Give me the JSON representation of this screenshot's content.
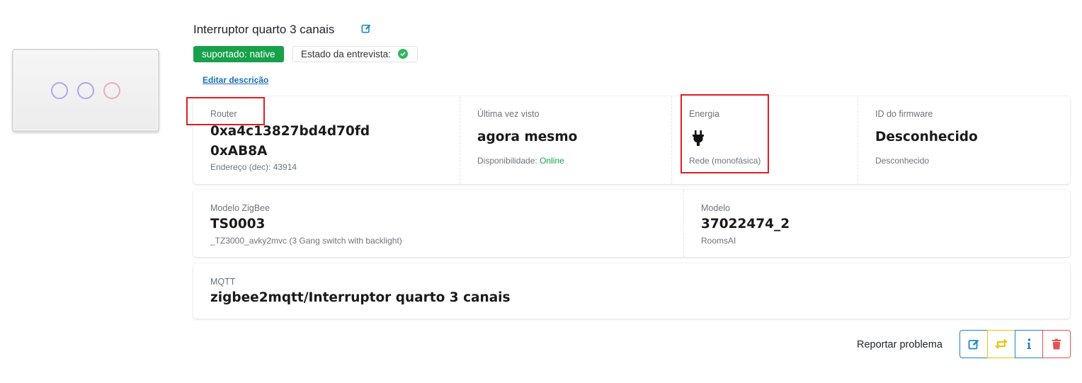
{
  "device": {
    "title": "Interruptor quarto 3 canais",
    "supported_badge": "suportado: native",
    "interview_label": "Estado da entrevista:",
    "edit_description": "Editar descrição"
  },
  "info": {
    "router_label": "Router",
    "ieee_address": "0xa4c13827bd4d70fd",
    "network_address": "0xAB8A",
    "address_dec": "Endereço (dec): 43914",
    "last_seen_label": "Última vez visto",
    "last_seen_value": "agora mesmo",
    "availability_label": "Disponibilidade:",
    "availability_value": "Online",
    "power_label": "Energia",
    "power_icon": "plug-icon",
    "power_source": "Rede (monofásica)",
    "firmware_label": "ID do firmware",
    "firmware_value": "Desconhecido",
    "firmware_sub": "Desconhecido"
  },
  "model": {
    "zigbee_model_label": "Modelo ZigBee",
    "zigbee_model_value": "TS0003",
    "zigbee_model_sub": "_TZ3000_avky2mvc (3 Gang switch with backlight)",
    "model_label": "Modelo",
    "model_value": "37022474_2",
    "vendor": "RoomsAI"
  },
  "mqtt": {
    "label": "MQTT",
    "topic": "zigbee2mqtt/Interruptor quarto 3 canais"
  },
  "actions": {
    "report_problem": "Reportar problema",
    "buttons": [
      "edit-icon",
      "swap-icon",
      "info-icon",
      "trash-icon"
    ]
  },
  "colors": {
    "accent": "#1b88c4",
    "success": "#17a14b",
    "warning": "#f2c200",
    "danger": "#e55353",
    "highlight": "#e01e27"
  }
}
